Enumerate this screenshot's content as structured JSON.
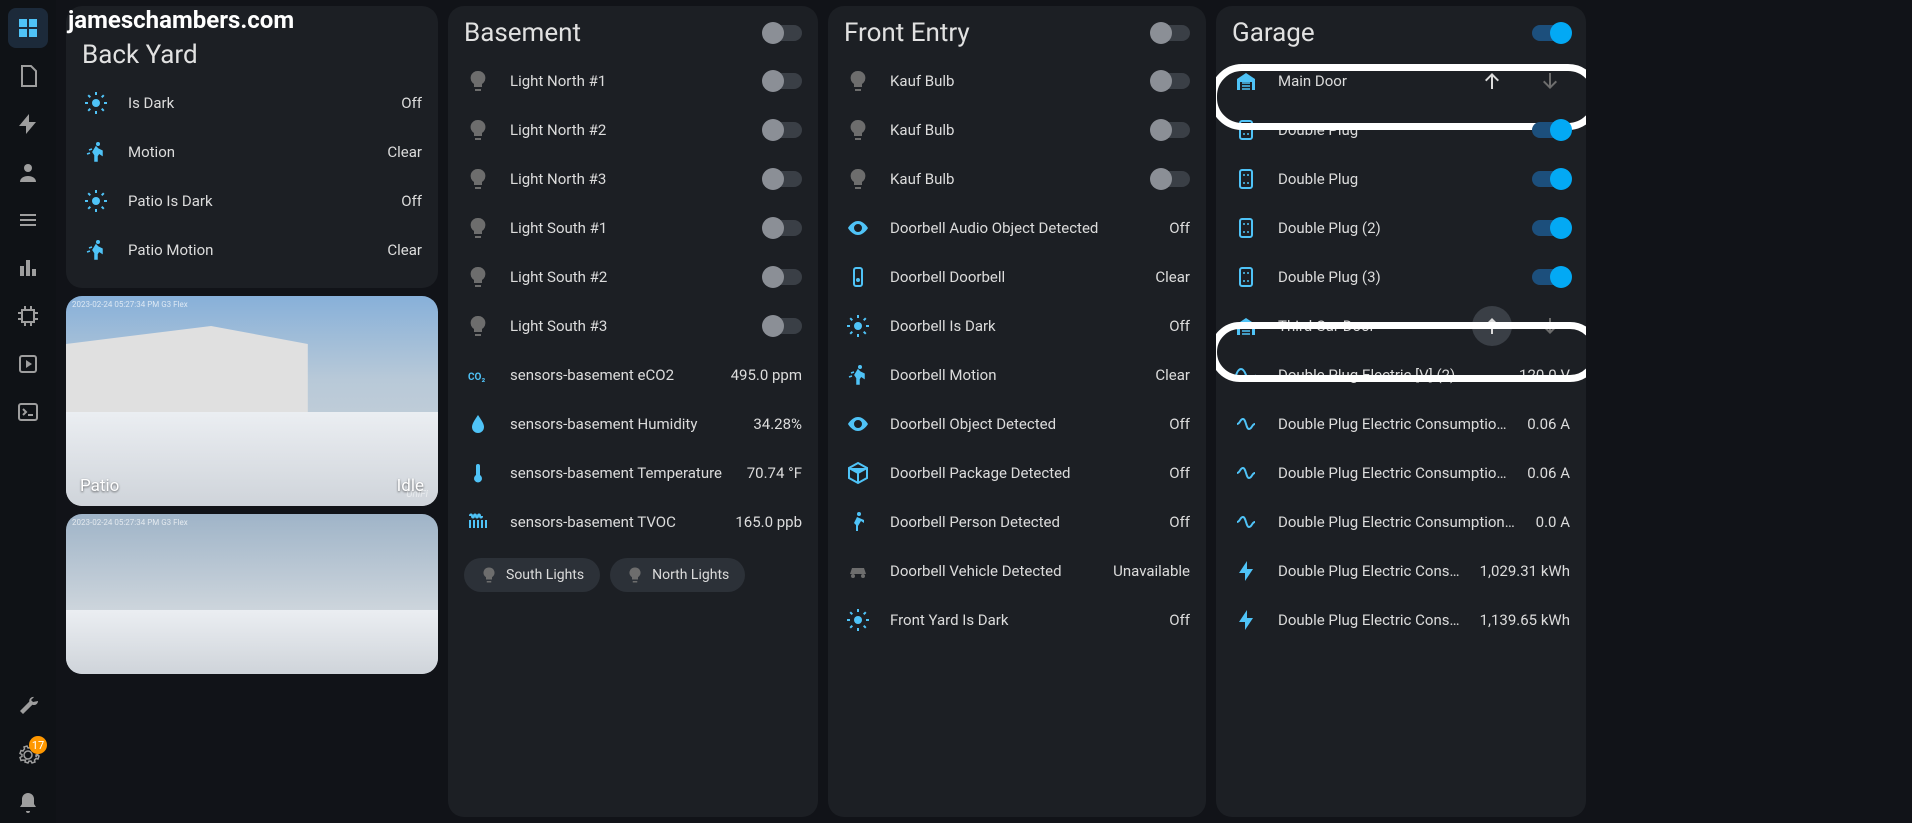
{
  "watermark": "jameschambers.com",
  "sidebar": {
    "notification_count": "17"
  },
  "backyard": {
    "title": "Back Yard",
    "rows": [
      {
        "label": "Is Dark",
        "value": "Off"
      },
      {
        "label": "Motion",
        "value": "Clear"
      },
      {
        "label": "Patio Is Dark",
        "value": "Off"
      },
      {
        "label": "Patio Motion",
        "value": "Clear"
      }
    ],
    "camera1": {
      "name": "Patio",
      "state": "Idle",
      "brand": "UniFi",
      "timestamp": "2023-02-24 05:27:34 PM  G3 Flex"
    },
    "camera2": {
      "timestamp": "2023-02-24 05:27:34 PM  G3 Flex"
    }
  },
  "basement": {
    "title": "Basement",
    "lights": [
      "Light North #1",
      "Light North #2",
      "Light North #3",
      "Light South #1",
      "Light South #2",
      "Light South #3"
    ],
    "sensors": [
      {
        "label": "sensors-basement eCO2",
        "value": "495.0 ppm"
      },
      {
        "label": "sensors-basement Humidity",
        "value": "34.28%"
      },
      {
        "label": "sensors-basement Temperature",
        "value": "70.74 °F"
      },
      {
        "label": "sensors-basement TVOC",
        "value": "165.0 ppb"
      }
    ],
    "chip_south": "South Lights",
    "chip_north": "North Lights"
  },
  "frontentry": {
    "title": "Front Entry",
    "bulbs": [
      "Kauf Bulb",
      "Kauf Bulb",
      "Kauf Bulb"
    ],
    "sensors": [
      {
        "label": "Doorbell Audio Object Detected",
        "value": "Off"
      },
      {
        "label": "Doorbell Doorbell",
        "value": "Clear"
      },
      {
        "label": "Doorbell Is Dark",
        "value": "Off"
      },
      {
        "label": "Doorbell Motion",
        "value": "Clear"
      },
      {
        "label": "Doorbell Object Detected",
        "value": "Off"
      },
      {
        "label": "Doorbell Package Detected",
        "value": "Off"
      },
      {
        "label": "Doorbell Person Detected",
        "value": "Off"
      },
      {
        "label": "Doorbell Vehicle Detected",
        "value": "Unavailable"
      },
      {
        "label": "Front Yard Is Dark",
        "value": "Off"
      }
    ]
  },
  "garage": {
    "title": "Garage",
    "main_door": "Main Door",
    "third_door": "Third Car Door",
    "plugs": [
      "Double Plug",
      "Double Plug",
      "Double Plug (2)",
      "Double Plug (3)"
    ],
    "metrics": [
      {
        "label": "Double Plug Electric [V] (2)",
        "value": "120.0 V"
      },
      {
        "label": "Double Plug Electric Consumption…",
        "value": "0.06 A"
      },
      {
        "label": "Double Plug Electric Consumption…",
        "value": "0.06 A"
      },
      {
        "label": "Double Plug Electric Consumption […",
        "value": "0.0 A"
      },
      {
        "label": "Double Plug Electric Consu…",
        "value": "1,029.31 kWh"
      },
      {
        "label": "Double Plug Electric Consu…",
        "value": "1,139.65 kWh"
      }
    ]
  }
}
